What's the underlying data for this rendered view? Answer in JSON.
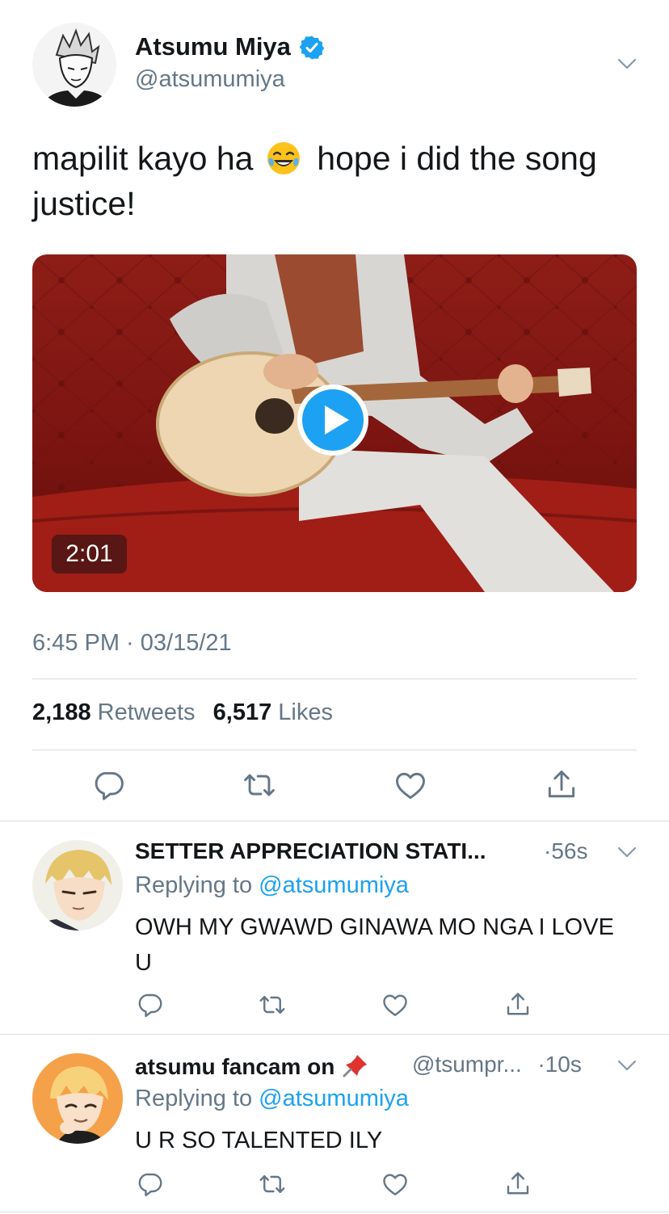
{
  "tweet": {
    "author_name": "Atsumu Miya",
    "author_handle": "@atsumumiya",
    "verified": true,
    "text_part1": "mapilit kayo ha",
    "text_emoji": "face-with-tears-of-joy",
    "text_part2": "hope i did the song justice!",
    "media": {
      "type": "video",
      "duration": "2:01"
    },
    "timestamp": "6:45 PM · 03/15/21",
    "retweets_count": "2,188",
    "retweets_label": "Retweets",
    "likes_count": "6,517",
    "likes_label": "Likes"
  },
  "replies": [
    {
      "author_name": "SETTER APPRECIATION STATI...",
      "time": "·56s",
      "replying_prefix": "Replying to",
      "replying_handle": "@atsumumiya",
      "text": "OWH MY GWAWD GINAWA MO NGA I LOVE U"
    },
    {
      "author_name": "atsumu fancam on",
      "name_emoji": "pushpin",
      "handle": "@tsumpr...",
      "time": "·10s",
      "replying_prefix": "Replying to",
      "replying_handle": "@atsumumiya",
      "text": "U R SO TALENTED ILY"
    }
  ],
  "colors": {
    "accent": "#1da1f2",
    "muted": "#657786",
    "text": "#14171a",
    "divider": "#d8dfe4"
  },
  "icons": [
    "chevron-down-icon",
    "verified-badge-icon",
    "play-icon",
    "reply-icon",
    "retweet-icon",
    "like-icon",
    "share-icon",
    "pushpin-icon",
    "laughing-emoji-icon"
  ]
}
